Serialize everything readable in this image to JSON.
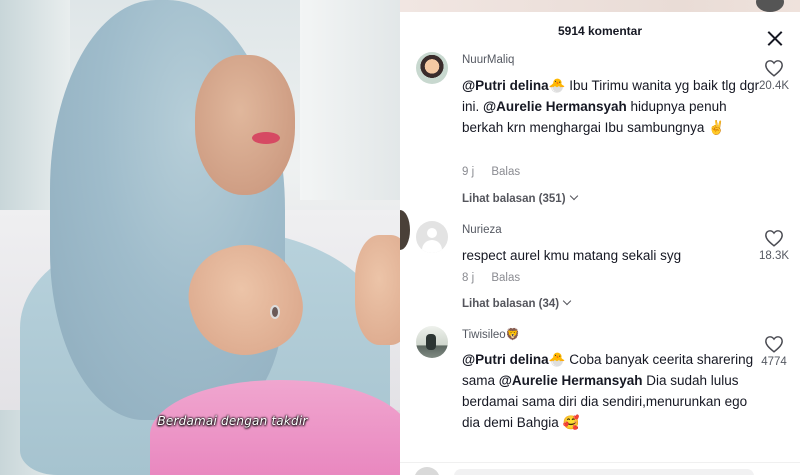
{
  "video": {
    "caption": "Berdamai dengan takdir"
  },
  "comments_panel": {
    "title": "5914 komentar",
    "comments": [
      {
        "username": "NuurMaliq",
        "mention1": "@Putri delina",
        "emoji1": "🐣",
        "line1_rest": " Ibu Tirimu wanita yg baik tlg dgr ini. ",
        "mention2": "@Aurelie Hermansyah",
        "line2_rest": " hidupnya penuh berkah krn menghargai Ibu sambungnya ✌️",
        "time": "9 j",
        "reply_label": "Balas",
        "view_replies": "Lihat balasan (351)",
        "likes": "20.4K"
      },
      {
        "username": "Nurieza",
        "text": "respect aurel kmu matang sekali syg",
        "time": "8 j",
        "reply_label": "Balas",
        "view_replies": "Lihat balasan (34)",
        "likes": "18.3K"
      },
      {
        "username": "Tiwisileo🦁",
        "mention1": "@Putri delina",
        "emoji1": "🐣",
        "line1_rest": " Coba banyak ceerita sharering sama ",
        "mention2": "@Aurelie Hermansyah",
        "line2_rest": " Dia sudah lulus berdamai sama diri dia sendiri,menurunkan ego dia demi Bahgia 🥰",
        "likes": "4774"
      }
    ]
  }
}
